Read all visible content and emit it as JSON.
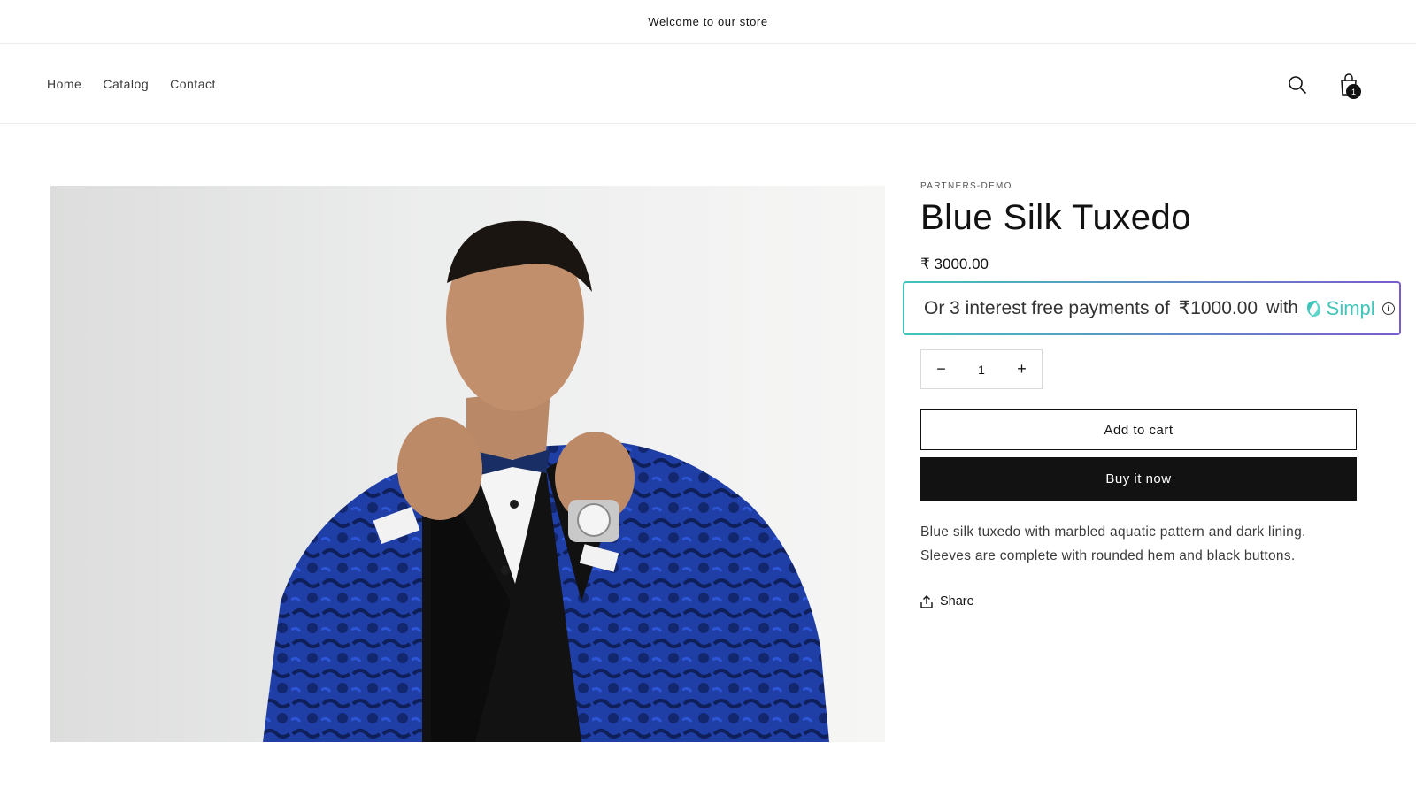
{
  "announcement": {
    "text": "Welcome to our store"
  },
  "nav": {
    "items": [
      {
        "label": "Home"
      },
      {
        "label": "Catalog"
      },
      {
        "label": "Contact"
      }
    ]
  },
  "header": {
    "search_icon": "search-icon",
    "cart_icon": "cart-icon",
    "cart_count": "1"
  },
  "product": {
    "vendor": "PARTNERS-DEMO",
    "title": "Blue Silk Tuxedo",
    "price": "₹ 3000.00",
    "image_alt": "Man wearing a blue silk tuxedo adjusting his bow tie",
    "quantity": "1",
    "decrease_label": "−",
    "increase_label": "+",
    "add_to_cart_label": "Add to cart",
    "buy_now_label": "Buy it now",
    "description": "Blue silk tuxedo with marbled aquatic pattern and dark lining. Sleeves are complete with rounded hem and black buttons.",
    "share_label": "Share"
  },
  "simpl": {
    "prefix": "Or 3 interest free payments of",
    "amount": "₹1000.00",
    "with": "with",
    "brand": "Simpl",
    "info_glyph": "i",
    "colors": {
      "start": "#41c4b9",
      "end": "#7a5ccf"
    }
  }
}
